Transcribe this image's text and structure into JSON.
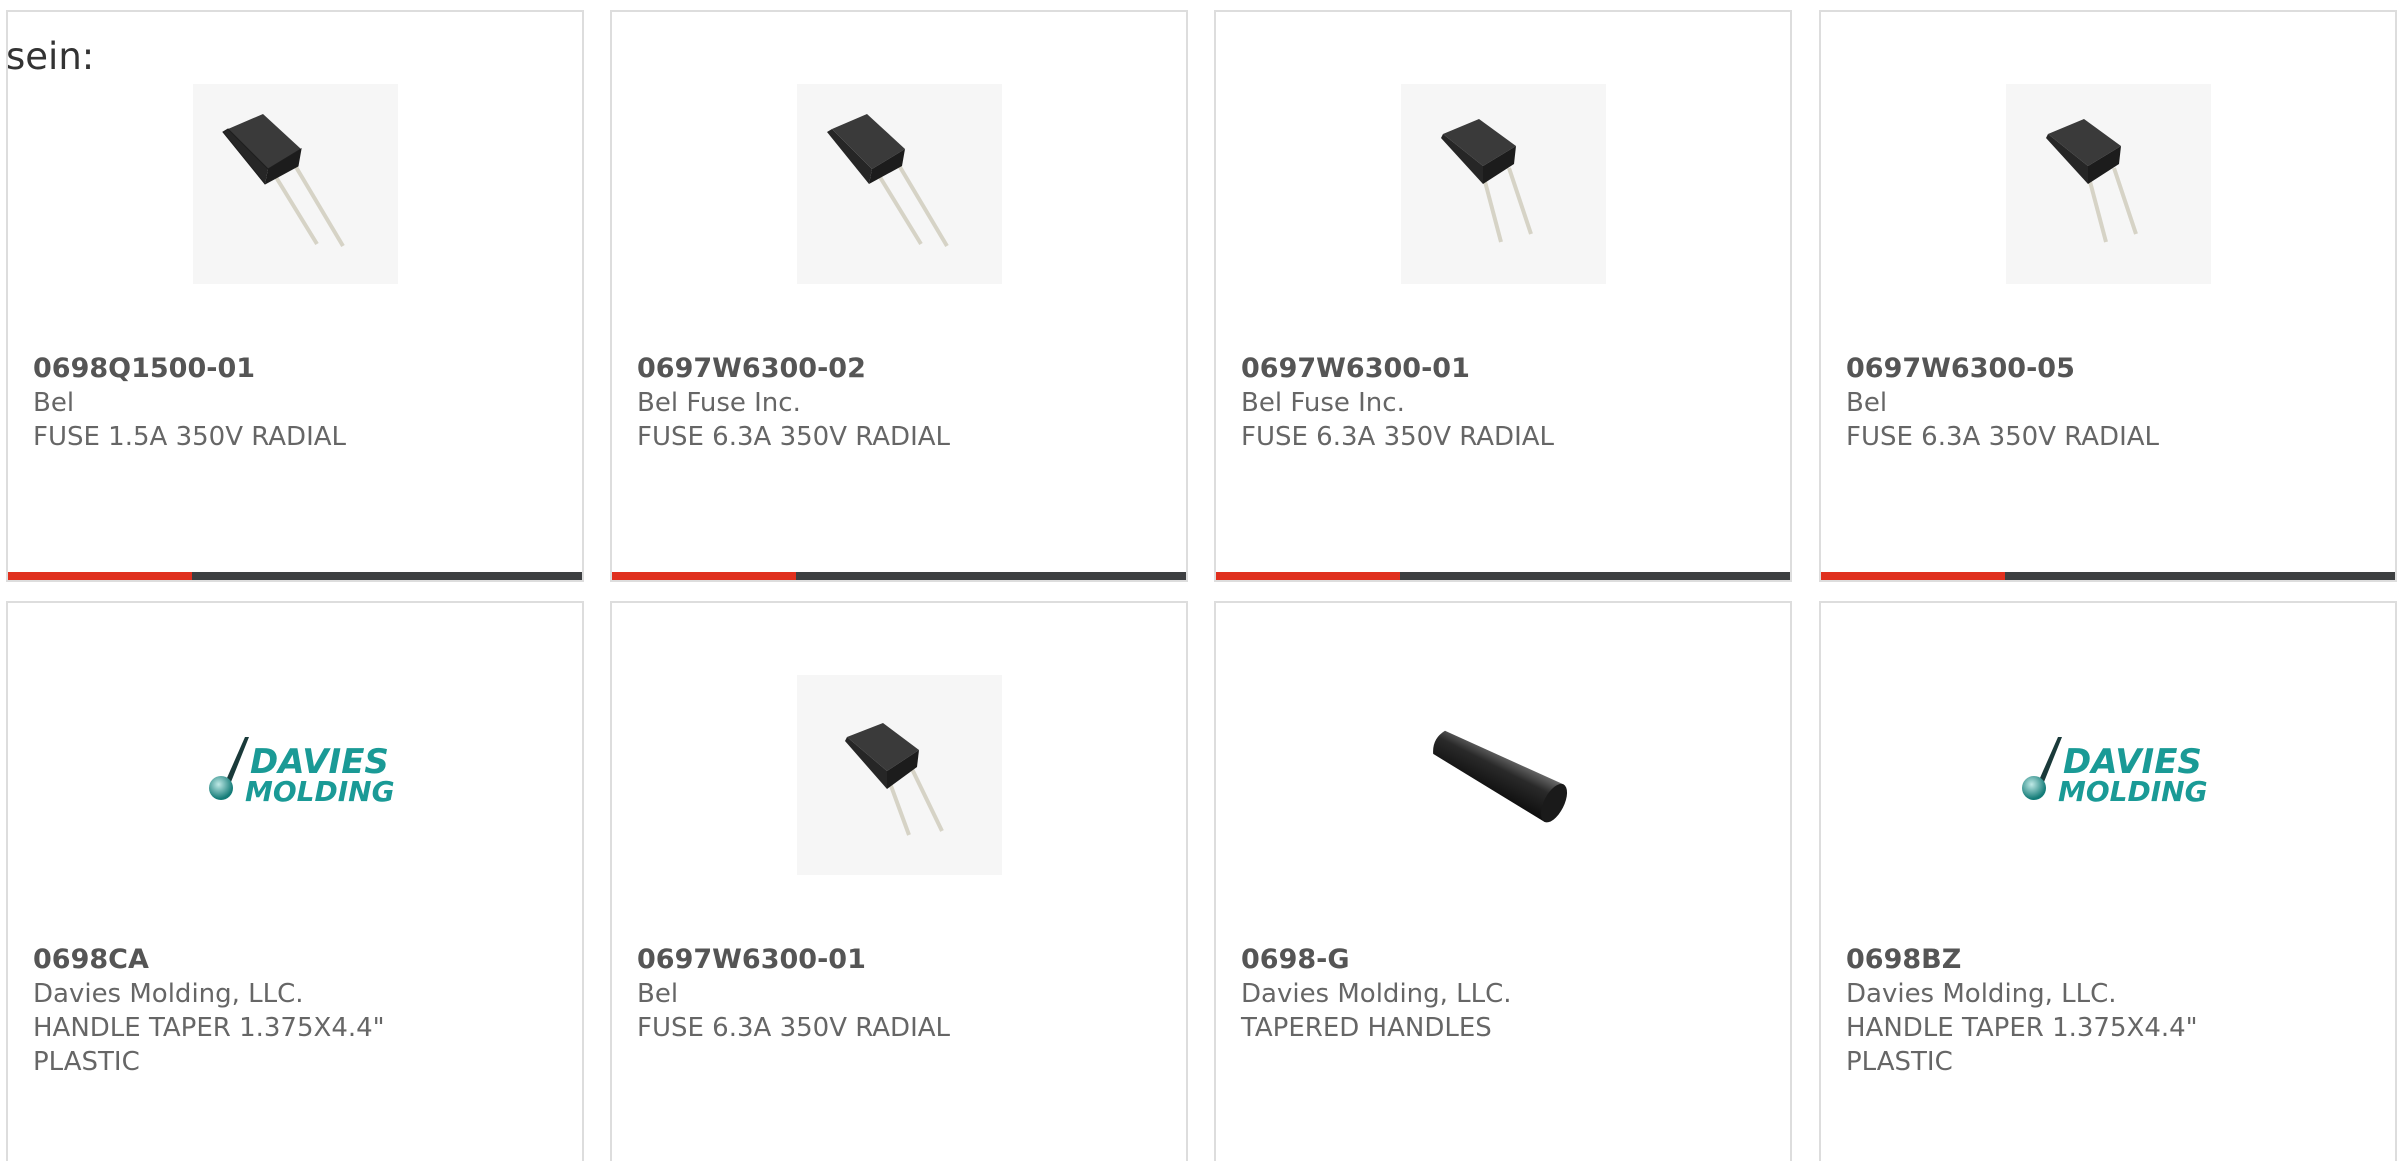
{
  "intro_text": "sein:",
  "cards": [
    {
      "part": "0698Q1500-01",
      "manufacturer": "Bel",
      "description": "FUSE 1.5A 350V RADIAL",
      "image": "fuse-image",
      "progress": 0.32
    },
    {
      "part": "0697W6300-02",
      "manufacturer": "Bel Fuse Inc.",
      "description": "FUSE 6.3A 350V RADIAL",
      "image": "fuse-image",
      "progress": 0.32
    },
    {
      "part": "0697W6300-01",
      "manufacturer": "Bel Fuse Inc.",
      "description": "FUSE 6.3A 350V RADIAL",
      "image": "fuse-image",
      "progress": 0.32
    },
    {
      "part": "0697W6300-05",
      "manufacturer": "Bel",
      "description": "FUSE 6.3A 350V RADIAL",
      "image": "fuse-image",
      "progress": 0.32
    },
    {
      "part": "0698CA",
      "manufacturer": "Davies Molding, LLC.",
      "description": "HANDLE TAPER 1.375X4.4\"",
      "description2": "PLASTIC",
      "image": "davies-molding-logo",
      "logo_line1": "DAVIES",
      "logo_line2": "MOLDING"
    },
    {
      "part": "0697W6300-01",
      "manufacturer": "Bel",
      "description": "FUSE 6.3A 350V RADIAL",
      "image": "fuse-image"
    },
    {
      "part": "0698-G",
      "manufacturer": "Davies Molding, LLC.",
      "description": "TAPERED HANDLES",
      "image": "tapered-handle-image"
    },
    {
      "part": "0698BZ",
      "manufacturer": "Davies Molding, LLC.",
      "description": "HANDLE TAPER 1.375X4.4\"",
      "description2": "PLASTIC",
      "image": "davies-molding-logo",
      "logo_line1": "DAVIES",
      "logo_line2": "MOLDING"
    }
  ],
  "colors": {
    "progress_fill": "#e0301e",
    "progress_track": "#3d3f41",
    "logo_teal": "#1a9a96"
  }
}
